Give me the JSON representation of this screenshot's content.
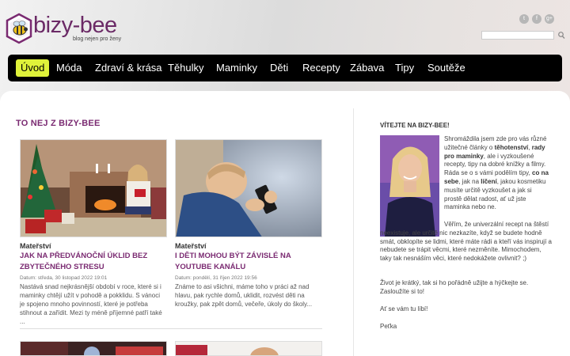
{
  "brand": {
    "name": "bizy-bee",
    "tagline": "blog nejen pro ženy",
    "color_primary": "#7a2a71",
    "color_accent": "#dff23a"
  },
  "social": [
    "twitter-icon",
    "facebook-icon",
    "google-plus-icon"
  ],
  "search": {
    "placeholder": ""
  },
  "nav": {
    "items": [
      {
        "label": "Úvod",
        "active": true
      },
      {
        "label": "Móda"
      },
      {
        "label": "Zdraví & krása"
      },
      {
        "label": "Těhulky"
      },
      {
        "label": "Maminky"
      },
      {
        "label": "Děti"
      },
      {
        "label": "Recepty"
      },
      {
        "label": "Zábava"
      },
      {
        "label": "Tipy"
      },
      {
        "label": "Soutěže"
      }
    ]
  },
  "main": {
    "section_title": "TO NEJ Z BIZY-BEE",
    "articles": [
      {
        "category": "Mateřství",
        "title": "JAK NA PŘEDVÁNOČNÍ ÚKLID BEZ ZBYTEČNÉHO STRESU",
        "date": "Datum: středa, 30 listopad 2022 19:01",
        "excerpt": "Nastává snad nejkrásnější období v roce, které si i maminky chtějí užít v pohodě a pokklidu. S vánoci je spojeno mnoho povinností, které je potřeba stihnout a zařídit. Mezi ty méně příjemné patří také ..."
      },
      {
        "category": "Mateřství",
        "title": "I DĚTI MOHOU BÝT ZÁVISLÉ NA YOUTUBE KANÁLU",
        "date": "Datum: pondělí, 31 říjen 2022 19:56",
        "excerpt": "Známe to asi všichni, máme toho v práci až nad hlavu, pak rychle domů, uklidit, rozvést děti na kroužky, pak zpět domů, večeře, úkoly do školy..."
      }
    ]
  },
  "sidebar": {
    "welcome_title": "VÍTEJTE NA BIZY-BEE!",
    "p1_a": "Shromáždila jsem zde pro vás různé užitečné články o ",
    "p1_b": "těhotenství",
    "p1_c": ", ",
    "p1_d": "rady pro maminky",
    "p1_e": ", ale i vyzkoušené recepty, tipy na dobré knížky a filmy. Ráda se o s vámi podělím tipy, ",
    "p1_f": "co na sebe",
    "p1_g": ", jak na ",
    "p1_h": "líčení",
    "p1_i": ", jakou kosmetiku musíte určitě vyzkoušet a jak si prostě dělat radost, ať už jste maminka nebo ne.",
    "p2": "Věřím, že univerzální recept na štěstí neexistuje, ale určitě nic nezkazíte, když se budete hodně smát, obklopíte se lidmi, které máte rádi a kteří vás inspirují a nebudete se trápit věcmi, které nezměníte. Mimochodem, taky tak nesnáším věci, které nedokážete ovlivnit? ;)",
    "p3": "Život je krátký, tak si ho pořádně užijte a hýčkejte se. Zasloužíte si to!",
    "p4": "Ať se vám tu líbí!",
    "signature": "Peťka"
  }
}
